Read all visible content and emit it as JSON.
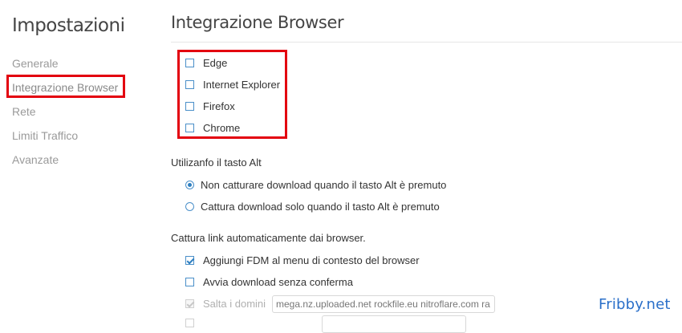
{
  "sidebar": {
    "title": "Impostazioni",
    "items": [
      {
        "label": "Generale"
      },
      {
        "label": "Integrazione Browser",
        "active": true
      },
      {
        "label": "Rete"
      },
      {
        "label": "Limiti Traffico"
      },
      {
        "label": "Avanzate"
      }
    ]
  },
  "main": {
    "title": "Integrazione Browser",
    "browsers": [
      {
        "label": "Edge",
        "checked": false
      },
      {
        "label": "Internet Explorer",
        "checked": false
      },
      {
        "label": "Firefox",
        "checked": false
      },
      {
        "label": "Chrome",
        "checked": false
      }
    ],
    "alt_key": {
      "heading": "Utilizanfo il tasto Alt",
      "options": [
        {
          "label": "Non catturare download quando il tasto Alt è premuto",
          "selected": true
        },
        {
          "label": "Cattura download solo quando il tasto Alt è premuto",
          "selected": false
        }
      ]
    },
    "auto_capture": {
      "heading": "Cattura link automaticamente dai browser.",
      "add_to_context_menu": {
        "label": "Aggiungi FDM al menu di contesto del browser",
        "checked": true
      },
      "start_without_confirm": {
        "label": "Avvia download senza conferma",
        "checked": false
      },
      "skip_domains": {
        "label": "Salta i domini",
        "checked": true,
        "disabled": true,
        "value": "mega.nz.uploaded.net rockfile.eu nitroflare.com ra"
      }
    }
  },
  "watermark": "Fribby.net",
  "colors": {
    "accent": "#2f7fc0",
    "highlight": "#e3000f",
    "watermark": "#2a6fc9"
  }
}
